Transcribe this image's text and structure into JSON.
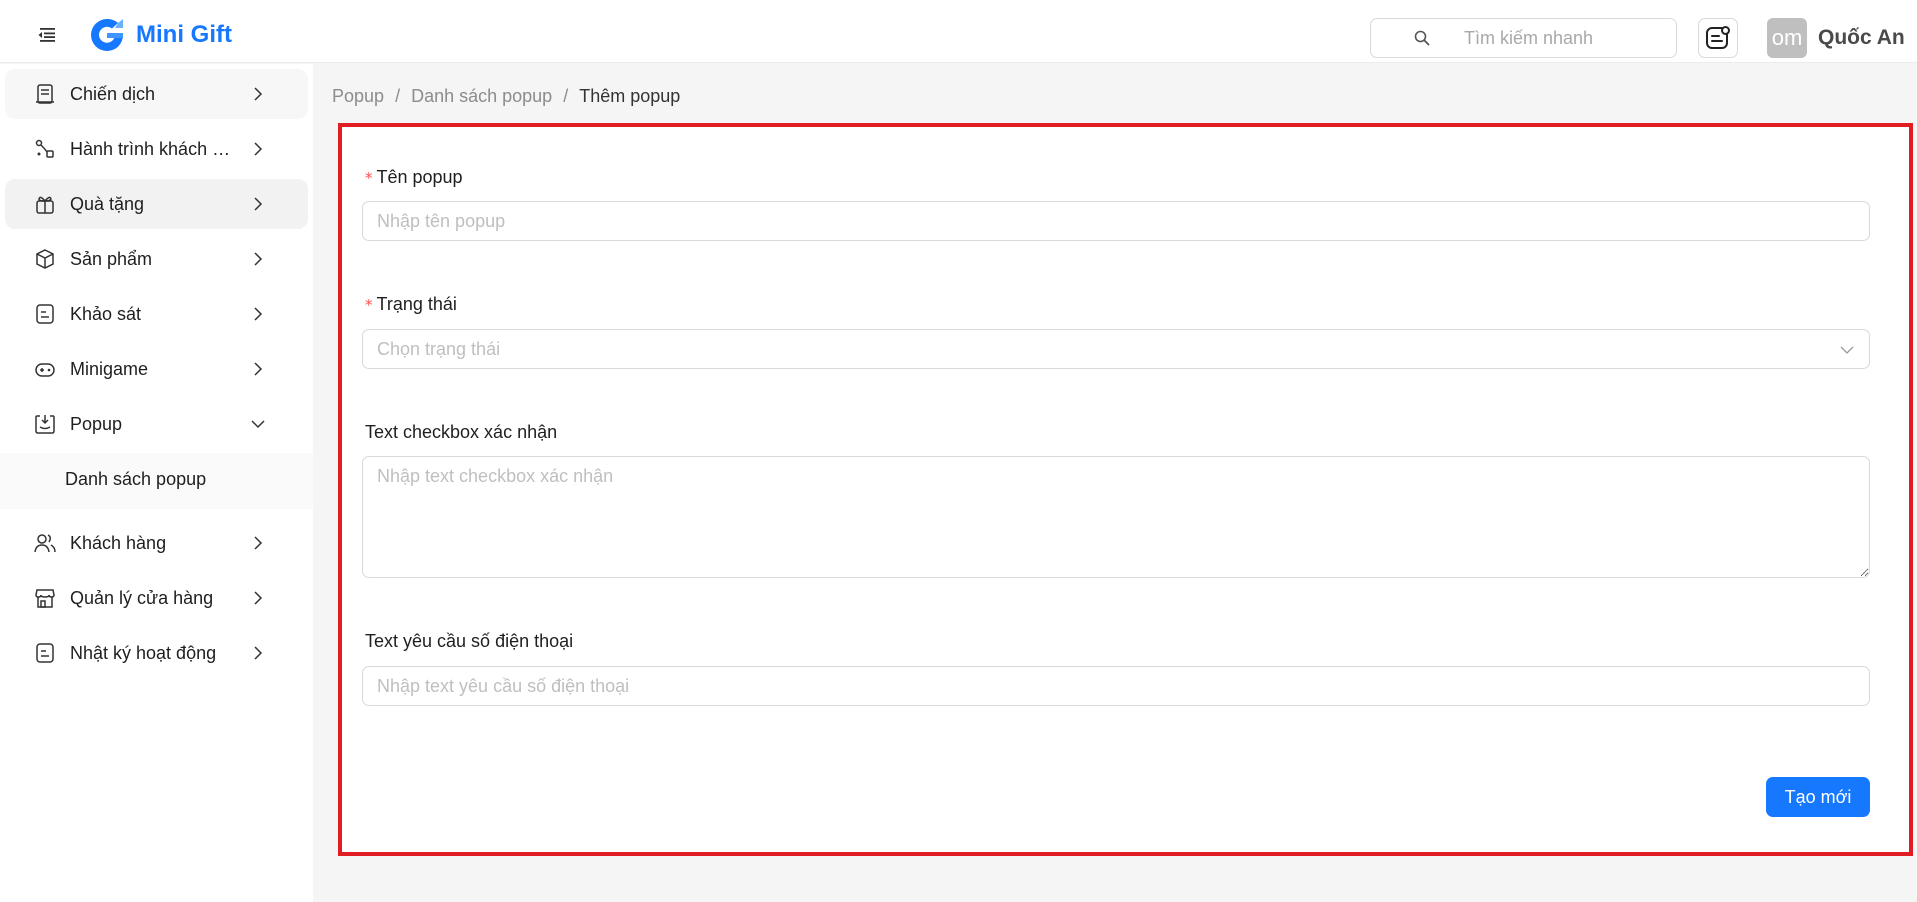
{
  "header": {
    "brand": "Mini Gift",
    "search_placeholder": "Tìm kiếm nhanh",
    "avatar_text": "om",
    "user_name": "Quốc An"
  },
  "sidebar": {
    "items": [
      {
        "label": "Chiến dịch",
        "icon": "campaign-icon"
      },
      {
        "label": "Hành trình khách hàng",
        "icon": "journey-icon"
      },
      {
        "label": "Quà tặng",
        "icon": "gift-icon"
      },
      {
        "label": "Sản phẩm",
        "icon": "product-box-icon"
      },
      {
        "label": "Khảo sát",
        "icon": "survey-icon"
      },
      {
        "label": "Minigame",
        "icon": "game-icon"
      },
      {
        "label": "Popup",
        "icon": "popup-icon",
        "expanded": true
      },
      {
        "label": "Khách hàng",
        "icon": "customers-icon"
      },
      {
        "label": "Quản lý cửa hàng",
        "icon": "store-icon"
      },
      {
        "label": "Nhật ký hoạt động",
        "icon": "activity-log-icon"
      }
    ],
    "popup_sub_items": [
      {
        "label": "Danh sách popup"
      }
    ]
  },
  "breadcrumb": {
    "items": [
      "Popup",
      "Danh sách popup",
      "Thêm popup"
    ],
    "separator": "/"
  },
  "form": {
    "name": {
      "label": "Tên popup",
      "placeholder": "Nhập tên popup",
      "required": true
    },
    "status": {
      "label": "Trạng thái",
      "placeholder": "Chọn trạng thái",
      "required": true
    },
    "checkbox_text": {
      "label": "Text checkbox xác nhận",
      "placeholder": "Nhập text checkbox xác nhận"
    },
    "phone_text": {
      "label": "Text yêu cầu số điện thoại",
      "placeholder": "Nhập text yêu cầu số điện thoại"
    },
    "required_mark": "*",
    "submit_label": "Tạo mới"
  },
  "colors": {
    "primary": "#1677ff",
    "highlight_border": "#e01d22",
    "required": "#ff4d4f"
  }
}
